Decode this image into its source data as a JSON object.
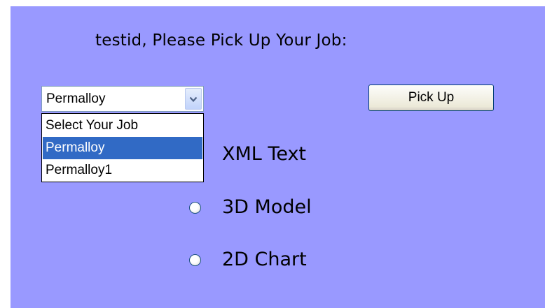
{
  "title": "testid, Please Pick Up Your Job:",
  "job_select": {
    "selected_value": "Permalloy",
    "options": [
      "Select Your Job",
      "Permalloy",
      "Permalloy1"
    ],
    "highlighted_index": 1
  },
  "pickup_button_label": "Pick Up",
  "output_options": [
    {
      "label": "XML Text",
      "checked": false
    },
    {
      "label": "3D Model",
      "checked": false
    },
    {
      "label": "2D Chart",
      "checked": false
    }
  ],
  "colors": {
    "background": "#9999ff",
    "highlight": "#316ac5"
  },
  "icons": {
    "select_arrow": "chevron-down-icon"
  }
}
